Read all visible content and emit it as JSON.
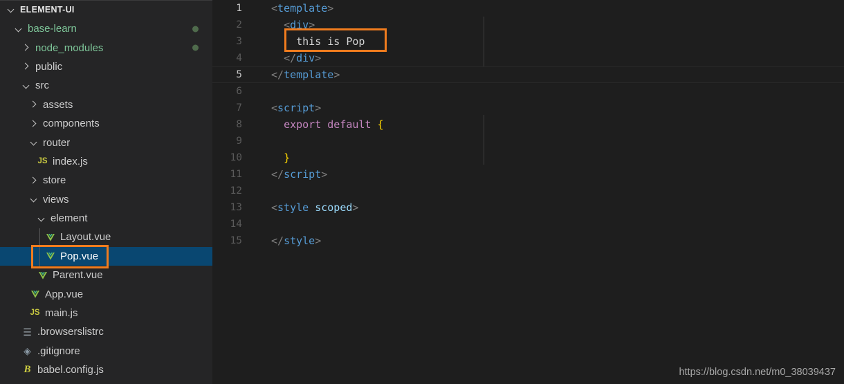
{
  "app": {
    "title": "Visual Studio Code",
    "theme": "dark-plus",
    "colors": {
      "sidebar_bg": "#252526",
      "editor_bg": "#1e1e1e",
      "selection_bg": "#094771",
      "annotation": "#f07c1e",
      "git_dot": "#4f6b4c",
      "vue_icon": "#8dc149",
      "js_icon": "#cbcb41"
    }
  },
  "sidebar": {
    "root_label": "ELEMENT-UI",
    "items": [
      {
        "label": "base-learn",
        "depth": 1,
        "kind": "folder",
        "twisty": "down",
        "icon": "",
        "git_dot": true,
        "selected": false
      },
      {
        "label": "node_modules",
        "depth": 2,
        "kind": "folder",
        "twisty": "right",
        "icon": "",
        "git_dot": true,
        "selected": false
      },
      {
        "label": "public",
        "depth": 2,
        "kind": "folder",
        "twisty": "right",
        "icon": "",
        "git_dot": false,
        "selected": false
      },
      {
        "label": "src",
        "depth": 2,
        "kind": "folder",
        "twisty": "down",
        "icon": "",
        "git_dot": false,
        "selected": false
      },
      {
        "label": "assets",
        "depth": 3,
        "kind": "folder",
        "twisty": "right",
        "icon": "",
        "git_dot": false,
        "selected": false
      },
      {
        "label": "components",
        "depth": 3,
        "kind": "folder",
        "twisty": "right",
        "icon": "",
        "git_dot": false,
        "selected": false
      },
      {
        "label": "router",
        "depth": 3,
        "kind": "folder",
        "twisty": "down",
        "icon": "",
        "git_dot": false,
        "selected": false
      },
      {
        "label": "index.js",
        "depth": 4,
        "kind": "file",
        "twisty": "none",
        "icon": "js-file-icon",
        "git_dot": false,
        "selected": false
      },
      {
        "label": "store",
        "depth": 3,
        "kind": "folder",
        "twisty": "right",
        "icon": "",
        "git_dot": false,
        "selected": false
      },
      {
        "label": "views",
        "depth": 3,
        "kind": "folder",
        "twisty": "down",
        "icon": "",
        "git_dot": false,
        "selected": false
      },
      {
        "label": "element",
        "depth": 4,
        "kind": "folder",
        "twisty": "down",
        "icon": "",
        "git_dot": false,
        "selected": false
      },
      {
        "label": "Layout.vue",
        "depth": 5,
        "kind": "file",
        "twisty": "none",
        "icon": "vue-file-icon",
        "git_dot": false,
        "selected": false
      },
      {
        "label": "Pop.vue",
        "depth": 5,
        "kind": "file",
        "twisty": "none",
        "icon": "vue-file-icon",
        "git_dot": false,
        "selected": true
      },
      {
        "label": "Parent.vue",
        "depth": 4,
        "kind": "file",
        "twisty": "none",
        "icon": "vue-file-icon",
        "git_dot": false,
        "selected": false
      },
      {
        "label": "App.vue",
        "depth": 3,
        "kind": "file",
        "twisty": "none",
        "icon": "vue-file-icon",
        "git_dot": false,
        "selected": false
      },
      {
        "label": "main.js",
        "depth": 3,
        "kind": "file",
        "twisty": "none",
        "icon": "js-file-icon",
        "git_dot": false,
        "selected": false
      },
      {
        "label": ".browserslistrc",
        "depth": 2,
        "kind": "file",
        "twisty": "none",
        "icon": "config-list-icon",
        "git_dot": false,
        "selected": false
      },
      {
        "label": ".gitignore",
        "depth": 2,
        "kind": "file",
        "twisty": "none",
        "icon": "git-icon",
        "git_dot": false,
        "selected": false
      },
      {
        "label": "babel.config.js",
        "depth": 2,
        "kind": "file",
        "twisty": "none",
        "icon": "babel-icon",
        "git_dot": false,
        "selected": false
      }
    ]
  },
  "editor": {
    "language": "vue",
    "current_line": 5,
    "lines": [
      {
        "no": "1",
        "tokens": [
          {
            "t": "<",
            "c": "punct"
          },
          {
            "t": "template",
            "c": "tag"
          },
          {
            "t": ">",
            "c": "punct"
          }
        ]
      },
      {
        "no": "2",
        "tokens": [
          {
            "t": "  ",
            "c": "text"
          },
          {
            "t": "<",
            "c": "punct"
          },
          {
            "t": "div",
            "c": "tag"
          },
          {
            "t": ">",
            "c": "punct"
          }
        ]
      },
      {
        "no": "3",
        "tokens": [
          {
            "t": "    this is Pop",
            "c": "text"
          }
        ]
      },
      {
        "no": "4",
        "tokens": [
          {
            "t": "  ",
            "c": "text"
          },
          {
            "t": "</",
            "c": "punct"
          },
          {
            "t": "div",
            "c": "tag"
          },
          {
            "t": ">",
            "c": "punct"
          }
        ]
      },
      {
        "no": "5",
        "tokens": [
          {
            "t": "</",
            "c": "punct"
          },
          {
            "t": "template",
            "c": "tag"
          },
          {
            "t": ">",
            "c": "punct"
          }
        ]
      },
      {
        "no": "6",
        "tokens": []
      },
      {
        "no": "7",
        "tokens": [
          {
            "t": "<",
            "c": "punct"
          },
          {
            "t": "script",
            "c": "tag"
          },
          {
            "t": ">",
            "c": "punct"
          }
        ]
      },
      {
        "no": "8",
        "tokens": [
          {
            "t": "  ",
            "c": "text"
          },
          {
            "t": "export",
            "c": "kw"
          },
          {
            "t": " ",
            "c": "text"
          },
          {
            "t": "default",
            "c": "kw"
          },
          {
            "t": " ",
            "c": "text"
          },
          {
            "t": "{",
            "c": "brace"
          }
        ]
      },
      {
        "no": "9",
        "tokens": []
      },
      {
        "no": "10",
        "tokens": [
          {
            "t": "  ",
            "c": "text"
          },
          {
            "t": "}",
            "c": "brace"
          }
        ]
      },
      {
        "no": "11",
        "tokens": [
          {
            "t": "</",
            "c": "punct"
          },
          {
            "t": "script",
            "c": "tag"
          },
          {
            "t": ">",
            "c": "punct"
          }
        ]
      },
      {
        "no": "12",
        "tokens": []
      },
      {
        "no": "13",
        "tokens": [
          {
            "t": "<",
            "c": "punct"
          },
          {
            "t": "style",
            "c": "tag"
          },
          {
            "t": " ",
            "c": "text"
          },
          {
            "t": "scoped",
            "c": "attr"
          },
          {
            "t": ">",
            "c": "punct"
          }
        ]
      },
      {
        "no": "14",
        "tokens": []
      },
      {
        "no": "15",
        "tokens": [
          {
            "t": "</",
            "c": "punct"
          },
          {
            "t": "style",
            "c": "tag"
          },
          {
            "t": ">",
            "c": "punct"
          }
        ]
      }
    ]
  },
  "annotations": [
    {
      "name": "code-highlight-box",
      "target": "this is Pop"
    },
    {
      "name": "file-highlight-box",
      "target": "Pop.vue"
    }
  ],
  "watermark": {
    "text": "https://blog.csdn.net/m0_38039437"
  }
}
